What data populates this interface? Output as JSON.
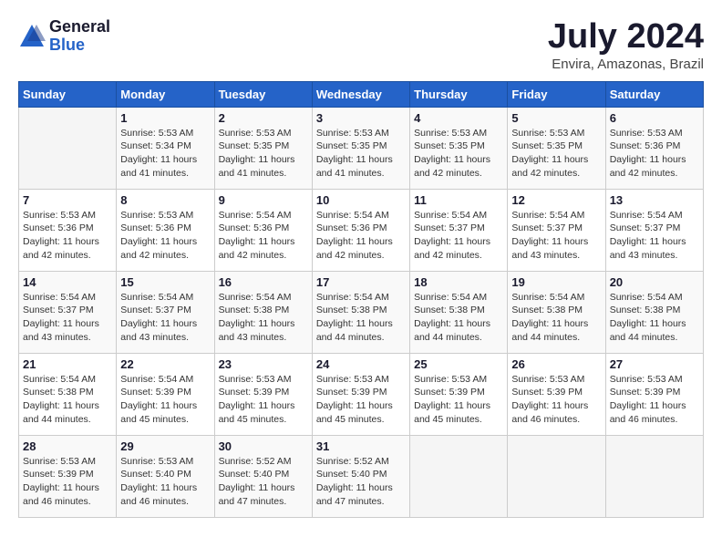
{
  "header": {
    "logo_general": "General",
    "logo_blue": "Blue",
    "month_title": "July 2024",
    "location": "Envira, Amazonas, Brazil"
  },
  "calendar": {
    "days_of_week": [
      "Sunday",
      "Monday",
      "Tuesday",
      "Wednesday",
      "Thursday",
      "Friday",
      "Saturday"
    ],
    "weeks": [
      [
        {
          "day": "",
          "info": ""
        },
        {
          "day": "1",
          "info": "Sunrise: 5:53 AM\nSunset: 5:34 PM\nDaylight: 11 hours and 41 minutes."
        },
        {
          "day": "2",
          "info": "Sunrise: 5:53 AM\nSunset: 5:35 PM\nDaylight: 11 hours and 41 minutes."
        },
        {
          "day": "3",
          "info": "Sunrise: 5:53 AM\nSunset: 5:35 PM\nDaylight: 11 hours and 41 minutes."
        },
        {
          "day": "4",
          "info": "Sunrise: 5:53 AM\nSunset: 5:35 PM\nDaylight: 11 hours and 42 minutes."
        },
        {
          "day": "5",
          "info": "Sunrise: 5:53 AM\nSunset: 5:35 PM\nDaylight: 11 hours and 42 minutes."
        },
        {
          "day": "6",
          "info": "Sunrise: 5:53 AM\nSunset: 5:36 PM\nDaylight: 11 hours and 42 minutes."
        }
      ],
      [
        {
          "day": "7",
          "info": "Sunrise: 5:53 AM\nSunset: 5:36 PM\nDaylight: 11 hours and 42 minutes."
        },
        {
          "day": "8",
          "info": "Sunrise: 5:53 AM\nSunset: 5:36 PM\nDaylight: 11 hours and 42 minutes."
        },
        {
          "day": "9",
          "info": "Sunrise: 5:54 AM\nSunset: 5:36 PM\nDaylight: 11 hours and 42 minutes."
        },
        {
          "day": "10",
          "info": "Sunrise: 5:54 AM\nSunset: 5:36 PM\nDaylight: 11 hours and 42 minutes."
        },
        {
          "day": "11",
          "info": "Sunrise: 5:54 AM\nSunset: 5:37 PM\nDaylight: 11 hours and 42 minutes."
        },
        {
          "day": "12",
          "info": "Sunrise: 5:54 AM\nSunset: 5:37 PM\nDaylight: 11 hours and 43 minutes."
        },
        {
          "day": "13",
          "info": "Sunrise: 5:54 AM\nSunset: 5:37 PM\nDaylight: 11 hours and 43 minutes."
        }
      ],
      [
        {
          "day": "14",
          "info": "Sunrise: 5:54 AM\nSunset: 5:37 PM\nDaylight: 11 hours and 43 minutes."
        },
        {
          "day": "15",
          "info": "Sunrise: 5:54 AM\nSunset: 5:37 PM\nDaylight: 11 hours and 43 minutes."
        },
        {
          "day": "16",
          "info": "Sunrise: 5:54 AM\nSunset: 5:38 PM\nDaylight: 11 hours and 43 minutes."
        },
        {
          "day": "17",
          "info": "Sunrise: 5:54 AM\nSunset: 5:38 PM\nDaylight: 11 hours and 44 minutes."
        },
        {
          "day": "18",
          "info": "Sunrise: 5:54 AM\nSunset: 5:38 PM\nDaylight: 11 hours and 44 minutes."
        },
        {
          "day": "19",
          "info": "Sunrise: 5:54 AM\nSunset: 5:38 PM\nDaylight: 11 hours and 44 minutes."
        },
        {
          "day": "20",
          "info": "Sunrise: 5:54 AM\nSunset: 5:38 PM\nDaylight: 11 hours and 44 minutes."
        }
      ],
      [
        {
          "day": "21",
          "info": "Sunrise: 5:54 AM\nSunset: 5:38 PM\nDaylight: 11 hours and 44 minutes."
        },
        {
          "day": "22",
          "info": "Sunrise: 5:54 AM\nSunset: 5:39 PM\nDaylight: 11 hours and 45 minutes."
        },
        {
          "day": "23",
          "info": "Sunrise: 5:53 AM\nSunset: 5:39 PM\nDaylight: 11 hours and 45 minutes."
        },
        {
          "day": "24",
          "info": "Sunrise: 5:53 AM\nSunset: 5:39 PM\nDaylight: 11 hours and 45 minutes."
        },
        {
          "day": "25",
          "info": "Sunrise: 5:53 AM\nSunset: 5:39 PM\nDaylight: 11 hours and 45 minutes."
        },
        {
          "day": "26",
          "info": "Sunrise: 5:53 AM\nSunset: 5:39 PM\nDaylight: 11 hours and 46 minutes."
        },
        {
          "day": "27",
          "info": "Sunrise: 5:53 AM\nSunset: 5:39 PM\nDaylight: 11 hours and 46 minutes."
        }
      ],
      [
        {
          "day": "28",
          "info": "Sunrise: 5:53 AM\nSunset: 5:39 PM\nDaylight: 11 hours and 46 minutes."
        },
        {
          "day": "29",
          "info": "Sunrise: 5:53 AM\nSunset: 5:40 PM\nDaylight: 11 hours and 46 minutes."
        },
        {
          "day": "30",
          "info": "Sunrise: 5:52 AM\nSunset: 5:40 PM\nDaylight: 11 hours and 47 minutes."
        },
        {
          "day": "31",
          "info": "Sunrise: 5:52 AM\nSunset: 5:40 PM\nDaylight: 11 hours and 47 minutes."
        },
        {
          "day": "",
          "info": ""
        },
        {
          "day": "",
          "info": ""
        },
        {
          "day": "",
          "info": ""
        }
      ]
    ]
  }
}
